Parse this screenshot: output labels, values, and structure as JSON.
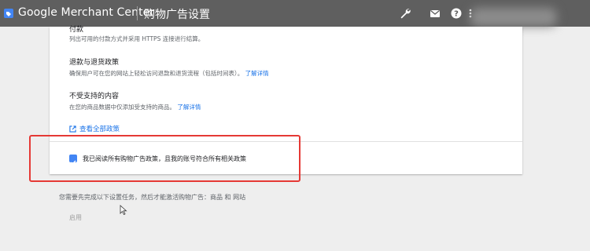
{
  "header": {
    "brand": "Google Merchant Center",
    "page_title": "购物广告设置",
    "icons": [
      "merchant-logo-icon",
      "wrench-icon",
      "mail-icon",
      "help-icon",
      "more-vert-icon"
    ]
  },
  "policies": {
    "payment": {
      "title": "付款",
      "desc": "列出可用的付款方式并采用 HTTPS 连接进行结算。"
    },
    "refund": {
      "title": "退款与退货政策",
      "desc": "确保用户可在您的网站上轻松访问退款和退货流程（包括时间表）。",
      "link": "了解详情"
    },
    "unsupported": {
      "title": "不受支持的内容",
      "desc": "在您的商品数据中仅添加受支持的商品。",
      "link": "了解详情"
    },
    "view_all": "查看全部政策"
  },
  "agreement": {
    "checked": true,
    "label": "我已阅读所有购物广告政策，且我的账号符合所有相关政策"
  },
  "footer": {
    "note": "您需要先完成以下设置任务，然后才能激活购物广告：商品 和 网站",
    "enable_button": "启用"
  },
  "colors": {
    "topbar": "#5f5f5f",
    "link": "#1a73e8",
    "checkbox": "#4285f4",
    "highlight": "#e53935"
  }
}
